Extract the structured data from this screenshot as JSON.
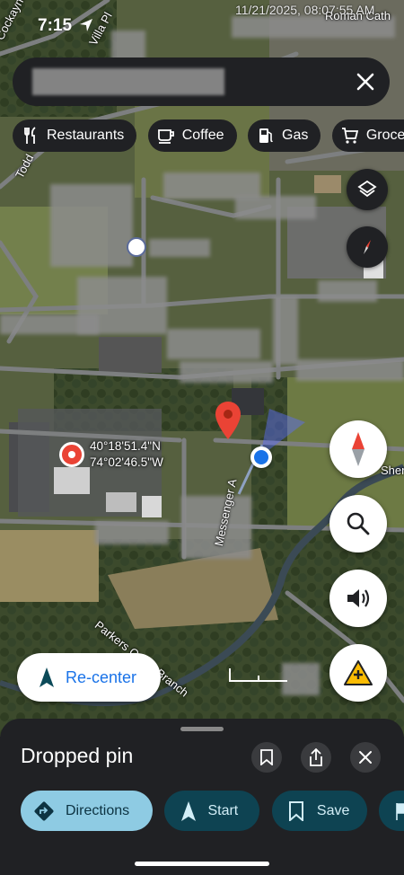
{
  "status_bar": {
    "time": "7:15"
  },
  "timestamp_overlay": "11/21/2025, 08:07:55 AM",
  "search": {
    "close_icon": "close-icon"
  },
  "chips": [
    {
      "label": "Restaurants",
      "icon": "fork-knife-icon"
    },
    {
      "label": "Coffee",
      "icon": "coffee-cup-icon"
    },
    {
      "label": "Gas",
      "icon": "gas-pump-icon"
    },
    {
      "label": "Groceries",
      "icon": "shopping-cart-icon"
    }
  ],
  "map": {
    "dropped_pin_coords": {
      "lat": "40°18'51.4\"N",
      "lon": "74°02'46.5\"W"
    },
    "street_labels": {
      "cockayne": "Cockayne Ct",
      "villa": "Villa Pl",
      "toddy": "Todd",
      "messenger": "Messenger A",
      "parkers": "Parkers Creek Branch",
      "sher": "Sher",
      "roman": "Roman Cath"
    }
  },
  "controls": {
    "layers_icon": "layers-icon",
    "compass_icon": "compass-icon",
    "navigation_compass_icon": "compass-needle-icon",
    "search_icon": "search-icon",
    "sound_icon": "speaker-icon",
    "report_icon": "report-incident-icon"
  },
  "recenter": {
    "label": "Re-center"
  },
  "sheet": {
    "title": "Dropped pin",
    "actions": [
      {
        "label": "Directions",
        "icon": "directions-icon",
        "style": "primary"
      },
      {
        "label": "Start",
        "icon": "navigation-arrow-icon",
        "style": "secondary"
      },
      {
        "label": "Save",
        "icon": "bookmark-icon",
        "style": "secondary"
      },
      {
        "label": "",
        "icon": "flag-icon",
        "style": "secondary"
      }
    ]
  },
  "colors": {
    "accent_blue": "#1a73e8",
    "pin_red": "#ea4335",
    "sheet_bg": "#202124"
  }
}
